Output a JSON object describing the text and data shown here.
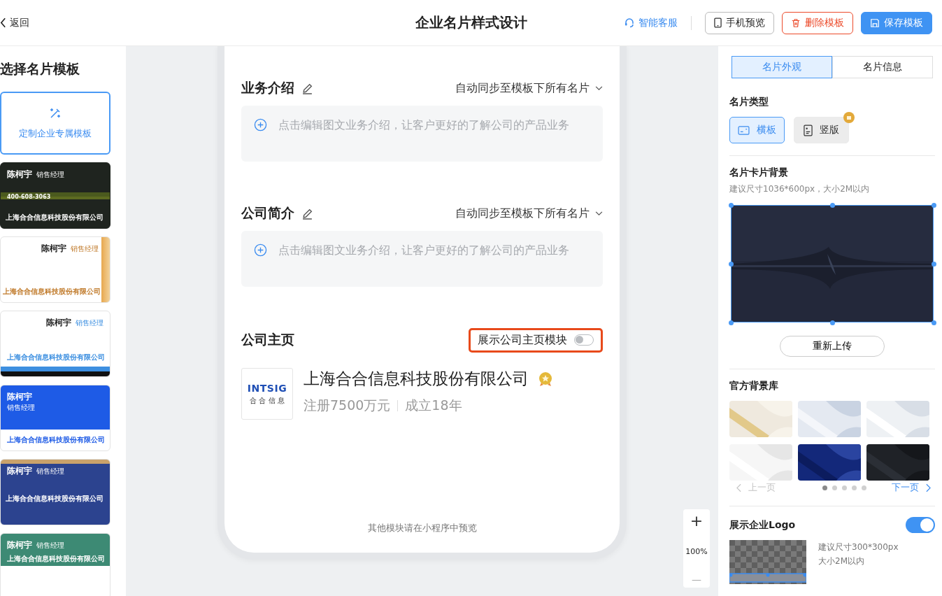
{
  "header": {
    "back": "返回",
    "title": "企业名片样式设计",
    "service": "智能客服",
    "buttons": [
      {
        "kind": "preview",
        "label": "手机预览"
      },
      {
        "kind": "delete",
        "label": "删除模板"
      },
      {
        "kind": "save",
        "label": "保存模板"
      }
    ]
  },
  "sidebar": {
    "title": "选择名片模板",
    "custom": "定制企业专属模板",
    "templates": [
      {
        "kind": "dark",
        "name": "陈柯宇",
        "role": "销售经理",
        "company": "上海合合信息科技股份有限公司",
        "phone": "400-608-3063"
      },
      {
        "kind": "gold",
        "name": "陈柯宇",
        "role": "销售经理",
        "company": "上海合合信息科技股份有限公司"
      },
      {
        "kind": "light",
        "name": "陈柯宇",
        "role": "销售经理",
        "company": "上海合合信息科技股份有限公司"
      },
      {
        "kind": "blue",
        "name": "陈柯宇",
        "role": "销售经理",
        "company": "上海合合信息科技股份有限公司"
      },
      {
        "kind": "navy",
        "name": "陈柯宇",
        "role": "销售经理",
        "company": "上海合合信息科技股份有限公司"
      },
      {
        "kind": "green",
        "name": "陈柯宇",
        "role": "销售经理",
        "company": "上海合合信息科技股份有限公司"
      }
    ]
  },
  "phone": {
    "sections": [
      {
        "title": "业务介绍",
        "sync": "自动同步至模板下所有名片",
        "placeholder": "点击编辑图文业务介绍，让客户更好的了解公司的产品业务"
      },
      {
        "title": "公司简介",
        "sync": "自动同步至模板下所有名片",
        "placeholder": "点击编辑图文业务介绍，让客户更好的了解公司的产品业务"
      }
    ],
    "homepage": {
      "title": "公司主页",
      "toggle_label": "展示公司主页模块",
      "on": false,
      "highlighted": true,
      "company": {
        "logo_text": "INTSIG",
        "logo_subtext": "合 合 信 息",
        "name": "上海合合信息科技股份有限公司",
        "capital": "注册7500万元",
        "founded": "成立18年"
      }
    },
    "footer": "其他模块请在小程序中预览"
  },
  "zoom": {
    "plus": "+",
    "level": "100%",
    "minus": "—"
  },
  "panel": {
    "tabs": [
      {
        "label": "名片外观",
        "selected": true
      },
      {
        "label": "名片信息",
        "selected": false
      }
    ],
    "card_type": {
      "title": "名片类型",
      "options": [
        {
          "kind": "landscape",
          "label": "横板",
          "selected": true,
          "locked": false
        },
        {
          "kind": "portrait",
          "label": "竖版",
          "selected": false,
          "locked": true
        }
      ]
    },
    "background": {
      "title": "名片卡片背景",
      "hint": "建议尺寸1036*600px，大小2M以内",
      "upload": "重新上传"
    },
    "library": {
      "title": "官方背景库",
      "prev": "上一页",
      "prev_disabled": true,
      "next": "下一页",
      "pages": [
        {
          "selected": true
        },
        {
          "selected": false
        },
        {
          "selected": false
        },
        {
          "selected": false
        },
        {
          "selected": false
        }
      ]
    },
    "logo": {
      "title": "展示企业Logo",
      "on": true,
      "hints": [
        "建议尺寸300*300px",
        "大小2M以内"
      ]
    }
  }
}
